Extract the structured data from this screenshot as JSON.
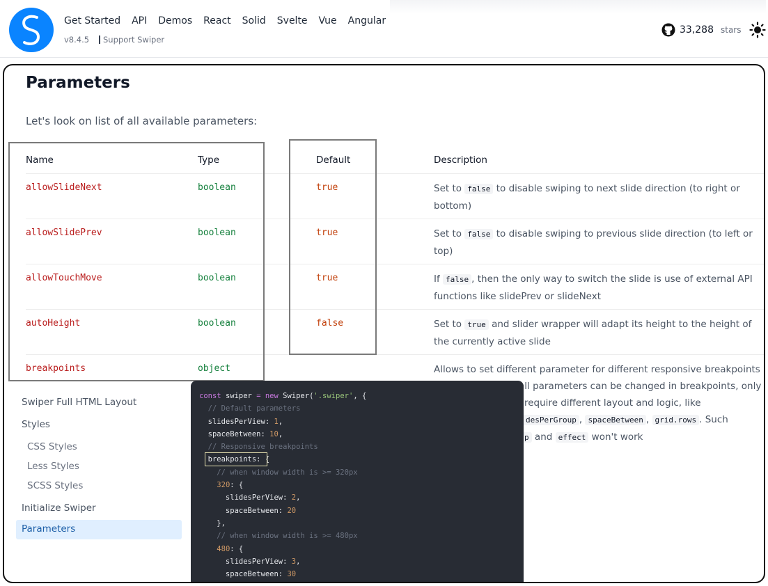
{
  "header": {
    "nav": [
      "Get Started",
      "API",
      "Demos",
      "React",
      "Solid",
      "Svelte",
      "Vue",
      "Angular"
    ],
    "version": "v8.4.5",
    "support": "Support Swiper",
    "stars_count": "33,288",
    "stars_label": "stars",
    "theme_icon": "sun-icon",
    "github_icon": "github-icon"
  },
  "content": {
    "title": "Parameters",
    "intro": "Let's look on list of all available parameters:",
    "columns": [
      "Name",
      "Type",
      "Default",
      "Description"
    ],
    "rows": [
      {
        "name": "allowSlideNext",
        "type": "boolean",
        "default": "true",
        "desc_pre": "Set to ",
        "desc_code": "false",
        "desc_post": " to disable swiping to next slide direction (to right or bottom)"
      },
      {
        "name": "allowSlidePrev",
        "type": "boolean",
        "default": "true",
        "desc_pre": "Set to ",
        "desc_code": "false",
        "desc_post": " to disable swiping to previous slide direction (to left or top)"
      },
      {
        "name": "allowTouchMove",
        "type": "boolean",
        "default": "true",
        "desc_pre": "If ",
        "desc_code": "false",
        "desc_post": ", then the only way to switch the slide is use of external API functions like slidePrev or slideNext"
      },
      {
        "name": "autoHeight",
        "type": "boolean",
        "default": "false",
        "desc_pre": "Set to ",
        "desc_code": "true",
        "desc_post": " and slider wrapper will adapt its height to the height of the currently active slide"
      },
      {
        "name": "breakpoints",
        "type": "object",
        "default": "",
        "desc_pre": "Allows to set different parameter for different responsive breakpoints",
        "desc_code": "",
        "desc_post": ""
      }
    ],
    "breakpoints_desc_lines": [
      "all parameters can be changed in breakpoints, only",
      "require different layout and logic, like",
      "desPerGroup",
      "spaceBetween",
      "grid.rows",
      ". Such",
      "p",
      "and",
      "effect",
      "won't work"
    ]
  },
  "sidebar": {
    "items": [
      "Swiper Full HTML Layout",
      "Styles",
      "CSS Styles",
      "Less Styles",
      "SCSS Styles",
      "Initialize Swiper",
      "Parameters"
    ]
  },
  "code": {
    "lines": [
      "const swiper = new Swiper('.swiper', {",
      "  // Default parameters",
      "  slidesPerView: 1,",
      "  spaceBetween: 10,",
      "  // Responsive breakpoints",
      "  breakpoints: {",
      "    // when window width is >= 320px",
      "    320: {",
      "      slidesPerView: 2,",
      "      spaceBetween: 20",
      "    },",
      "    // when window width is >= 480px",
      "    480: {",
      "      slidesPerView: 3,",
      "      spaceBetween: 30",
      "    }"
    ]
  },
  "colors": {
    "accent": "#0a84ff",
    "name": "#b91c1c",
    "type": "#15803d",
    "default": "#c2410c",
    "code_bg": "#282c34"
  }
}
